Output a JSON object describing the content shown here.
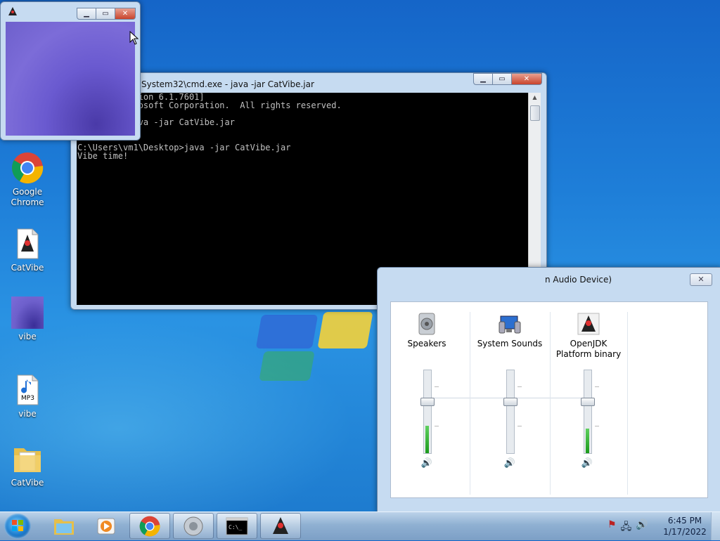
{
  "desktop": {
    "icons": [
      {
        "label": "Google Chrome"
      },
      {
        "label": "CatVibe"
      },
      {
        "label": "vibe"
      },
      {
        "label": "vibe",
        "badge": "MP3"
      },
      {
        "label": "CatVibe"
      }
    ]
  },
  "cmd": {
    "title": "System32\\cmd.exe - java  -jar CatVibe.jar",
    "lines": [
      "indows [Version 6.1.7601]",
      "c) 2009 Microsoft Corporation.  All rights reserved.",
      "",
      "1\\Desktop>java -jar CatVibe.jar",
      "",
      "",
      "C:\\Users\\vm1\\Desktop>java -jar CatVibe.jar",
      "Vibe time!"
    ]
  },
  "mixer": {
    "title": "n Audio Device)",
    "channels": [
      {
        "label": "Speakers",
        "icon": "speaker-icon",
        "level": 0.33,
        "slider": 0.66
      },
      {
        "label": "System Sounds",
        "icon": "system-sounds-icon",
        "level": 0.0,
        "slider": 0.66
      },
      {
        "label": "OpenJDK Platform binary",
        "icon": "java-icon",
        "level": 0.3,
        "slider": 0.66
      }
    ]
  },
  "taskbar": {
    "time": "6:45 PM",
    "date": "1/17/2022"
  },
  "colors": {
    "console_bg": "#000000",
    "console_text": "#c0c0c0",
    "accent": "#1c5db3"
  }
}
